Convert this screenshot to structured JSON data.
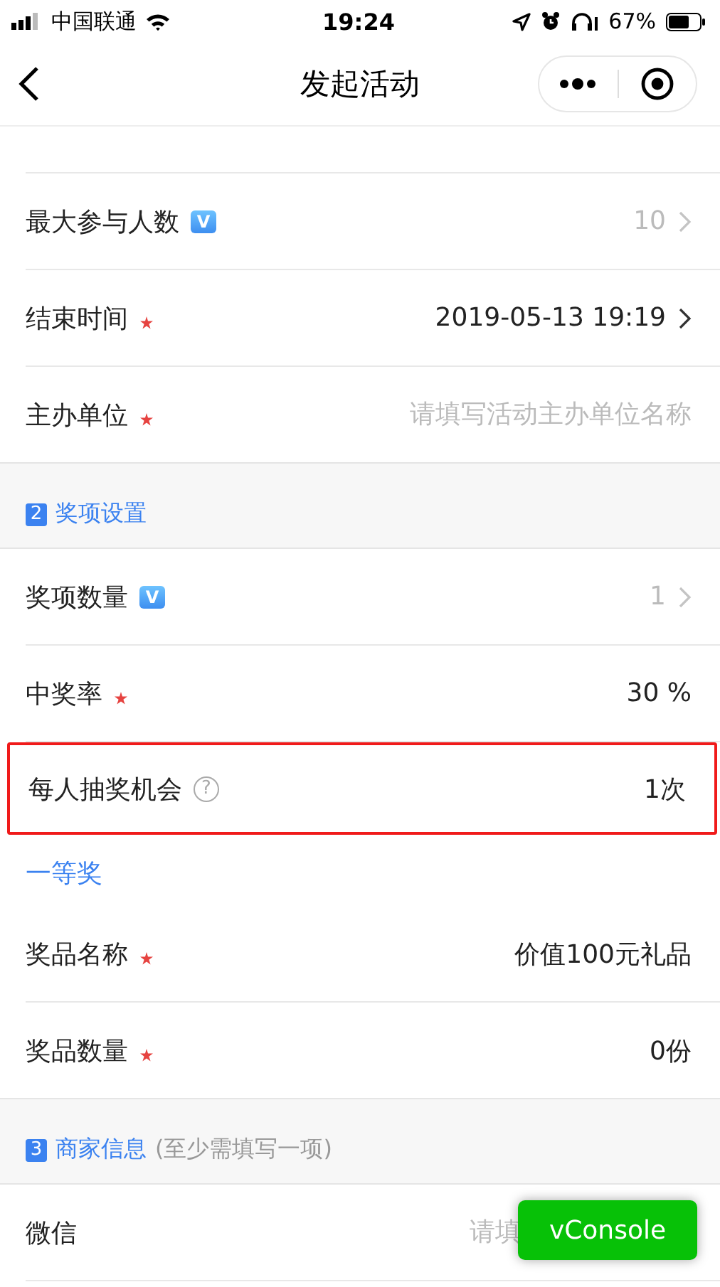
{
  "status_bar": {
    "carrier": "中国联通",
    "time": "19:24",
    "battery": "67%"
  },
  "nav": {
    "title": "发起活动"
  },
  "items": [
    {
      "kind": "row",
      "label": "最大参与人数",
      "required": false,
      "badge": "V",
      "value": "10",
      "muted": true,
      "chevron": true,
      "highlighted": false
    },
    {
      "kind": "row",
      "label": "结束时间",
      "required": true,
      "value": "2019-05-13 19:19",
      "muted": false,
      "chevron": true,
      "highlighted": false
    },
    {
      "kind": "row",
      "label": "主办单位",
      "required": true,
      "placeholder": "请填写活动主办单位名称",
      "chevron": false,
      "highlighted": false
    },
    {
      "kind": "section",
      "number": "2",
      "title": "奖项设置"
    },
    {
      "kind": "row",
      "label": "奖项数量",
      "required": false,
      "badge": "V",
      "value": "1",
      "muted": true,
      "chevron": true,
      "highlighted": false
    },
    {
      "kind": "row",
      "label": "中奖率",
      "required": true,
      "value": "30 %",
      "muted": false,
      "chevron": false,
      "highlighted": false
    },
    {
      "kind": "row",
      "label": "每人抽奖机会",
      "required": false,
      "help": "?",
      "value": "1次",
      "muted": false,
      "chevron": false,
      "highlighted": true
    },
    {
      "kind": "subheader",
      "title": "一等奖"
    },
    {
      "kind": "row",
      "label": "奖品名称",
      "required": true,
      "value": "价值100元礼品",
      "muted": false,
      "chevron": false,
      "highlighted": false
    },
    {
      "kind": "row",
      "label": "奖品数量",
      "required": true,
      "value": "0份",
      "muted": false,
      "chevron": false,
      "highlighted": false
    },
    {
      "kind": "section",
      "number": "3",
      "title": "商家信息",
      "note": "(至少需填写一项)"
    },
    {
      "kind": "row",
      "label": "微信",
      "required": false,
      "placeholder": "请填",
      "chevron": false,
      "highlighted": false
    }
  ],
  "console_button": {
    "label": "vConsole"
  }
}
